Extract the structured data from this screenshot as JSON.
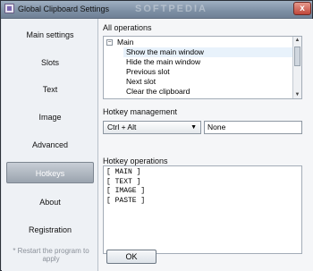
{
  "window": {
    "title": "Global Clipboard Settings",
    "watermark": "SOFTPEDIA",
    "close_label": "x"
  },
  "sidebar": {
    "items": [
      {
        "label": "Main settings"
      },
      {
        "label": "Slots"
      },
      {
        "label": "Text"
      },
      {
        "label": "Image"
      },
      {
        "label": "Advanced"
      },
      {
        "label": "Hotkeys",
        "active": true
      },
      {
        "label": "About"
      },
      {
        "label": "Registration"
      }
    ],
    "restart_note": "* Restart the program to apply"
  },
  "all_operations": {
    "label": "All operations",
    "tree": [
      {
        "label": "Main",
        "expander": "−"
      },
      {
        "label": "Show the main window",
        "selected": true
      },
      {
        "label": "Hide the main window"
      },
      {
        "label": "Previous slot"
      },
      {
        "label": "Next slot"
      },
      {
        "label": "Clear the clipboard"
      }
    ]
  },
  "hotkey_management": {
    "label": "Hotkey management",
    "modifier_selected": "Ctrl + Alt",
    "key_value": "None"
  },
  "hotkey_operations": {
    "label": "Hotkey operations",
    "lines": [
      "[ MAIN ]",
      "[ TEXT ]",
      "[ IMAGE ]",
      "[ PASTE ]"
    ]
  },
  "footer": {
    "ok_label": "OK"
  },
  "colors": {
    "selected_row": "#e8f2fb",
    "active_nav": "#9aa3ae"
  }
}
